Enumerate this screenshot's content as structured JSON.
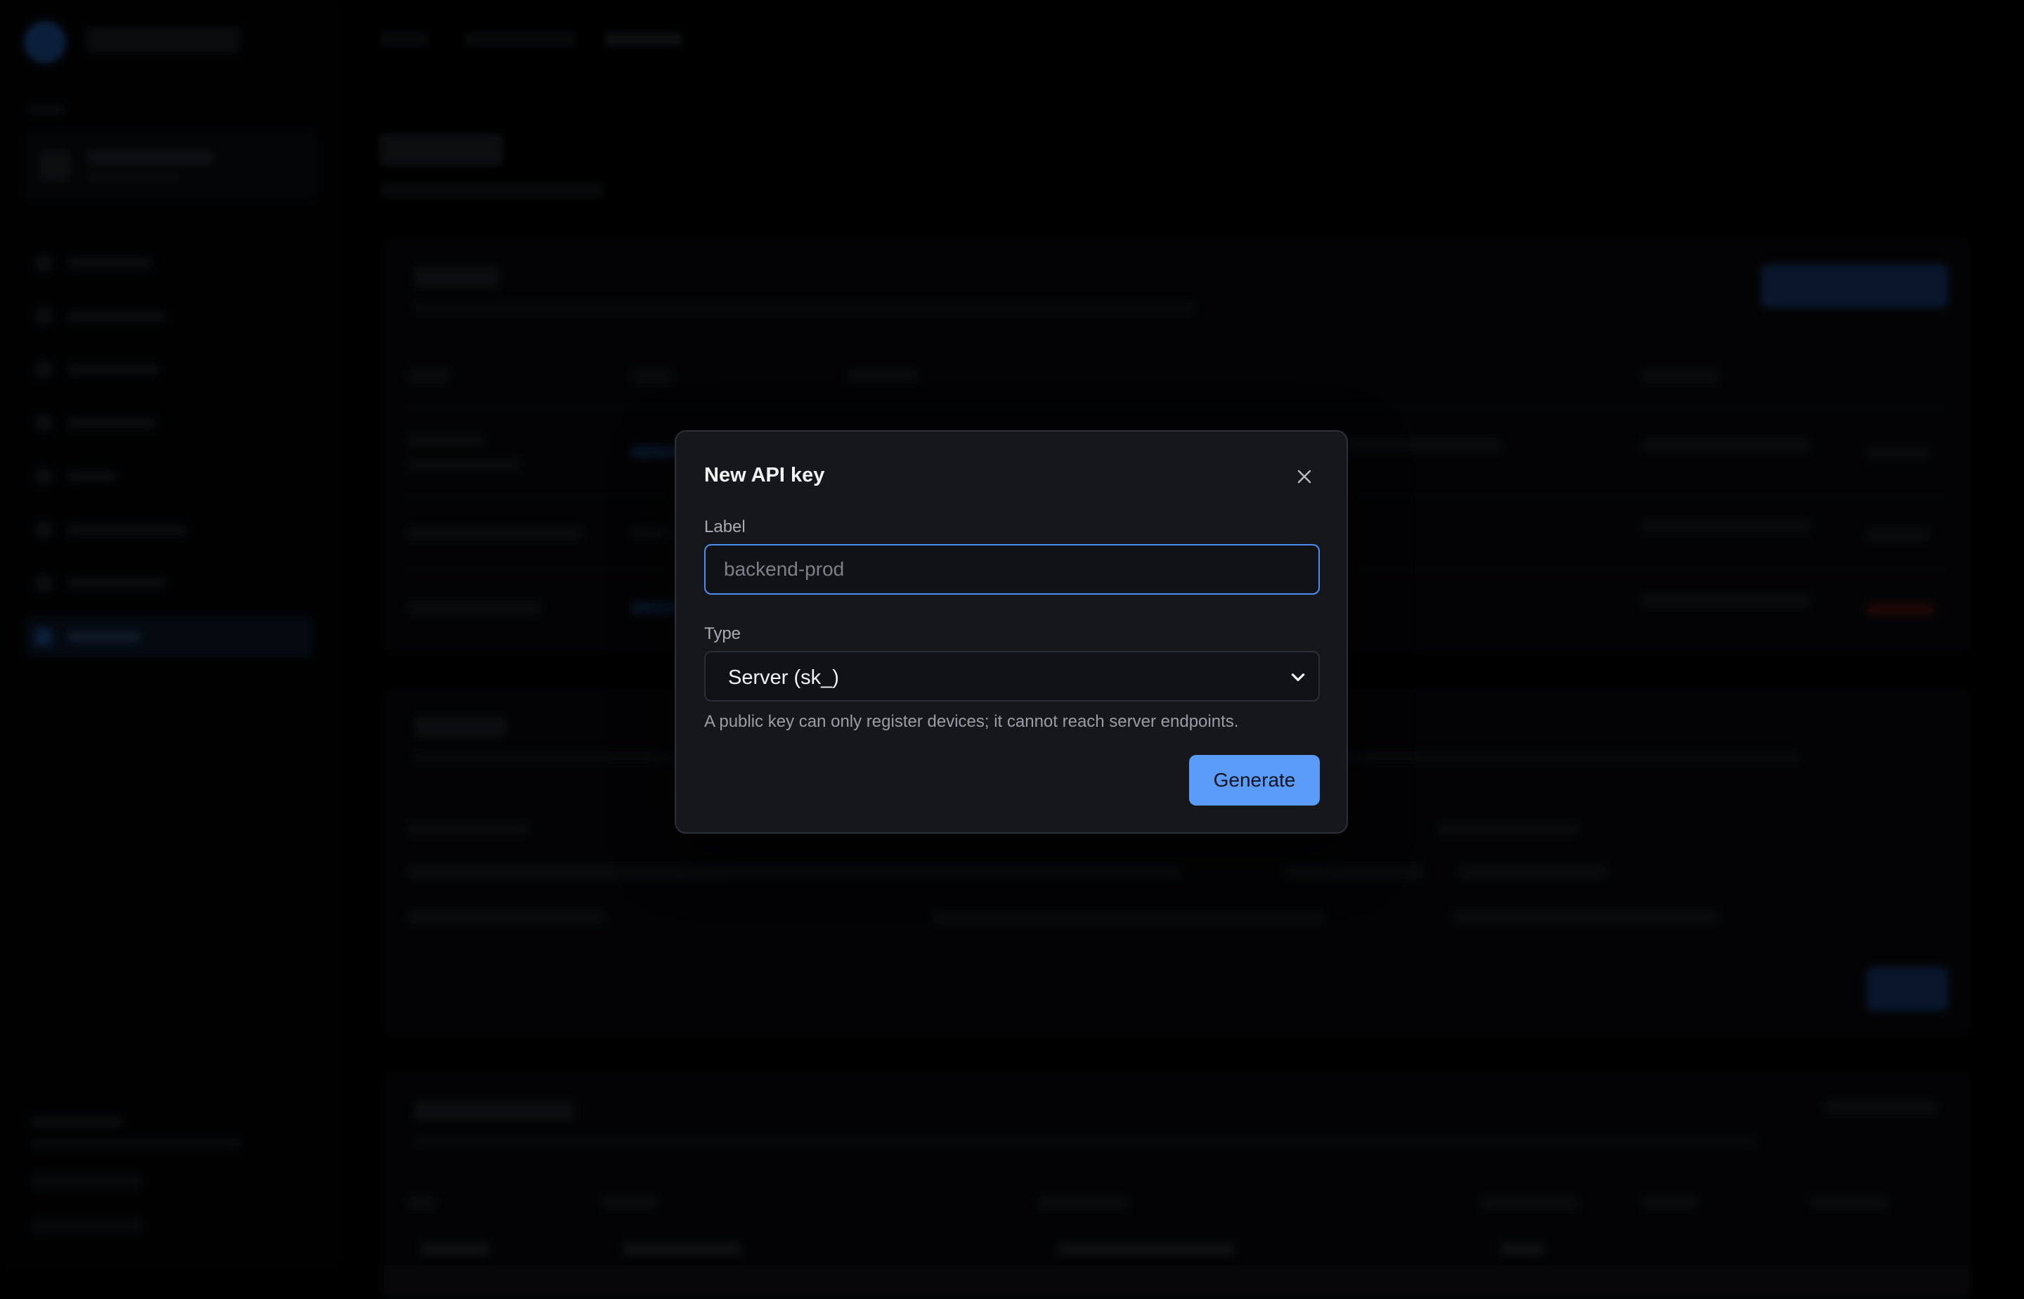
{
  "dialog": {
    "title": "New API key",
    "close_icon": "close-icon",
    "label_field": {
      "label": "Label",
      "value": "",
      "placeholder": "backend-prod"
    },
    "type_field": {
      "label": "Type",
      "selected": "Server (sk_)",
      "chevron_icon": "chevron-down-icon"
    },
    "hint": "A public key can only register devices; it cannot reach server endpoints.",
    "generate_label": "Generate"
  },
  "colors": {
    "accent": "#5a9cf7",
    "input_focus_border": "#4b8df0",
    "dialog_bg": "#16171b",
    "page_bg": "#000000"
  }
}
